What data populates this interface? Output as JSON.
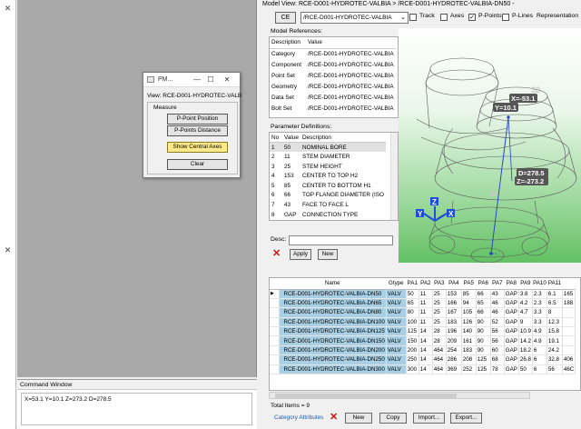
{
  "pm_window": {
    "title": "PM...",
    "view": "View: RCE-D001-HYDROTEC-VALB",
    "group": "Measure",
    "buttons": [
      "P-Point Position",
      "P-Points Distance",
      "Show Central Axes",
      "Clear"
    ]
  },
  "command_window": {
    "title": "Command Window",
    "output": "X=53.1 Y=10.1 Z=273.2 D=278.5"
  },
  "model_view": {
    "title": "Model View: RCE-D001-HYDROTEC-VALBIA > /RCE-D001-HYDROTEC-VALBIA-DN50 -",
    "ce_label": "CE",
    "view_select": "/RCE-D001-HYDROTEC-VALBIA",
    "checks": [
      {
        "label": "Track",
        "checked": false
      },
      {
        "label": "Axes",
        "checked": false
      },
      {
        "label": "P-Points",
        "checked": true
      },
      {
        "label": "P-Lines",
        "checked": false
      }
    ],
    "representation_label": "Representation"
  },
  "model_references": {
    "label": "Model References:",
    "headers": [
      "Description",
      "Value"
    ],
    "rows": [
      [
        "Category",
        "/RCE-D001-HYDROTEC-VALBIA"
      ],
      [
        "Component",
        "/RCE-D001-HYDROTEC-VALBIA"
      ],
      [
        "Point Set",
        "/RCE-D001-HYDROTEC-VALBIA"
      ],
      [
        "Geometry",
        "/RCE-D001-HYDROTEC-VALBIA"
      ],
      [
        "Data Set",
        "/RCE-D001-HYDROTEC-VALBIA"
      ],
      [
        "Bolt Set",
        "/RCE-D001-HYDROTEC-VALBIA"
      ]
    ]
  },
  "parameter_definitions": {
    "label": "Parameter Definitions:",
    "headers": [
      "No",
      "Value",
      "Description"
    ],
    "rows": [
      [
        "1",
        "50",
        "NOMINAL BORE"
      ],
      [
        "2",
        "11",
        "STEM DIAMETER"
      ],
      [
        "3",
        "25",
        "STEM HEIGHT"
      ],
      [
        "4",
        "153",
        "CENTER TO TOP H2"
      ],
      [
        "5",
        "85",
        "CENTER TO BOTTOM H1"
      ],
      [
        "6",
        "66",
        "TOP FLANGE DIAMETER (ISO"
      ],
      [
        "7",
        "43",
        "FACE TO FACE L"
      ],
      [
        "8",
        "GAP",
        "CONNECTION TYPE"
      ]
    ]
  },
  "desc": {
    "label": "Desc:",
    "apply": "Apply",
    "new": "New"
  },
  "viewport": {
    "labels": [
      "X=-53.1",
      "Y=10.1",
      "D=278.5",
      "Z=-273.2",
      "32",
      "30"
    ],
    "axes": [
      "Y",
      "Z",
      "X"
    ]
  },
  "grid": {
    "headers": [
      "Name",
      "Gtype",
      "PA1",
      "PA2",
      "PA3",
      "PA4",
      "PA5",
      "PA6",
      "PA7",
      "PA8",
      "PA9",
      "PA10",
      "PA11"
    ],
    "rows": [
      [
        "RCE-D001-HYDROTEC-VALBIA-DN50",
        "VALV",
        "50",
        "11",
        "25",
        "153",
        "85",
        "66",
        "43",
        "GAP",
        "3.8",
        "2.3",
        "6.1"
      ],
      [
        "RCE-D001-HYDROTEC-VALBIA-DN65",
        "VALV",
        "65",
        "11",
        "25",
        "166",
        "94",
        "65",
        "46",
        "GAP",
        "4.2",
        "2.3",
        "6.5"
      ],
      [
        "RCE-D001-HYDROTEC-VALBIA-DN80",
        "VALV",
        "80",
        "11",
        "25",
        "167",
        "105",
        "66",
        "46",
        "GAP",
        "4.7",
        "3.3",
        "8"
      ],
      [
        "RCE-D001-HYDROTEC-VALBIA-DN100",
        "VALV",
        "100",
        "11",
        "25",
        "183",
        "126",
        "90",
        "52",
        "GAP",
        "9",
        "3.3",
        "12.3"
      ],
      [
        "RCE-D001-HYDROTEC-VALBIA-DN125",
        "VALV",
        "125",
        "14",
        "28",
        "196",
        "140",
        "90",
        "56",
        "GAP",
        "10.9",
        "4.9",
        "15.8"
      ],
      [
        "RCE-D001-HYDROTEC-VALBIA-DN150",
        "VALV",
        "150",
        "14",
        "28",
        "209",
        "161",
        "90",
        "56",
        "GAP",
        "14.2",
        "4.9",
        "19.1"
      ],
      [
        "RCE-D001-HYDROTEC-VALBIA-DN200",
        "VALV",
        "200",
        "14",
        "464",
        "254",
        "183",
        "90",
        "60",
        "GAP",
        "18.2",
        "6",
        "24.2"
      ],
      [
        "RCE-D001-HYDROTEC-VALBIA-DN250",
        "VALV",
        "250",
        "14",
        "464",
        "286",
        "208",
        "125",
        "68",
        "GAP",
        "26.8",
        "6",
        "32.8"
      ],
      [
        "RCE-D001-HYDROTEC-VALBIA-DN300",
        "VALV",
        "300",
        "14",
        "464",
        "369",
        "252",
        "125",
        "78",
        "GAP",
        "50",
        "6",
        "56"
      ]
    ],
    "right_overflow": [
      "165",
      "188",
      "",
      "",
      "",
      "",
      "",
      "406",
      "46C"
    ]
  },
  "footer": {
    "total": "Total Items = 9",
    "category_attributes": "Category Attributes",
    "buttons": [
      "New",
      "Copy",
      "Import...",
      "Export..."
    ]
  },
  "colors": {
    "workspace": "#a9a9a9",
    "name_cell": "#a8cfe3",
    "highlight_button": "#ffe98a",
    "viewport_green": "#62c062",
    "label_bg": "#555555"
  }
}
